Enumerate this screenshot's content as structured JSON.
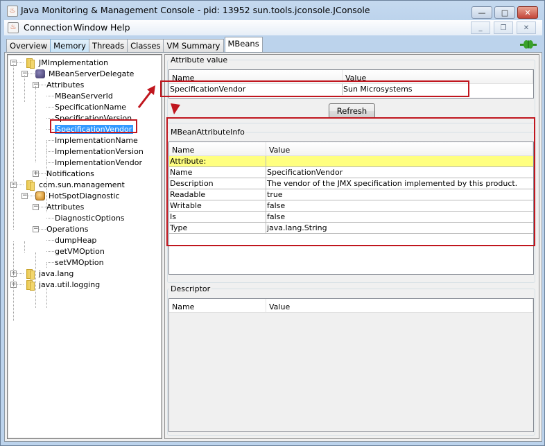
{
  "window": {
    "title": "Java Monitoring & Management Console - pid: 13952 sun.tools.jconsole.JConsole",
    "controls": {
      "minimize": "—",
      "maximize": "□",
      "close": "✕"
    }
  },
  "menubar": {
    "items": [
      "Connection",
      "Window",
      "Help"
    ],
    "inner_controls": {
      "minimize": "_",
      "restore": "❐",
      "close": "✕"
    }
  },
  "tabs": [
    {
      "label": "Overview",
      "state": "normal"
    },
    {
      "label": "Memory",
      "state": "hover"
    },
    {
      "label": "Threads",
      "state": "normal"
    },
    {
      "label": "Classes",
      "state": "normal"
    },
    {
      "label": "VM Summary",
      "state": "normal"
    },
    {
      "label": "MBeans",
      "state": "active"
    }
  ],
  "connection_icon": "connected-plug-icon",
  "tree": {
    "nodes": [
      {
        "label": "JMImplementation",
        "icon": "folder-icon",
        "level": 0,
        "expanded": true
      },
      {
        "label": "MBeanServerDelegate",
        "icon": "mbean-icon",
        "level": 1,
        "expanded": true
      },
      {
        "label": "Attributes",
        "icon": null,
        "level": 2,
        "expanded": true
      },
      {
        "label": "MBeanServerId",
        "level": 3
      },
      {
        "label": "SpecificationName",
        "level": 3
      },
      {
        "label": "SpecificationVersion",
        "level": 3
      },
      {
        "label": "SpecificationVendor",
        "level": 3,
        "selected": true
      },
      {
        "label": "ImplementationName",
        "level": 3
      },
      {
        "label": "ImplementationVersion",
        "level": 3
      },
      {
        "label": "ImplementationVendor",
        "level": 3
      },
      {
        "label": "Notifications",
        "level": 2,
        "expanded": false
      },
      {
        "label": "com.sun.management",
        "icon": "folder-icon",
        "level": 0,
        "expanded": true
      },
      {
        "label": "HotSpotDiagnostic",
        "icon": "mbean-icon",
        "level": 1,
        "expanded": true
      },
      {
        "label": "Attributes",
        "level": 2,
        "expanded": true
      },
      {
        "label": "DiagnosticOptions",
        "level": 3
      },
      {
        "label": "Operations",
        "level": 2,
        "expanded": true
      },
      {
        "label": "dumpHeap",
        "level": 3
      },
      {
        "label": "getVMOption",
        "level": 3
      },
      {
        "label": "setVMOption",
        "level": 3
      },
      {
        "label": "java.lang",
        "icon": "folder-icon",
        "level": 0,
        "expanded": false
      },
      {
        "label": "java.util.logging",
        "icon": "folder-icon",
        "level": 0,
        "expanded": false
      }
    ]
  },
  "attribute_value": {
    "title": "Attribute value",
    "columns": [
      "Name",
      "Value"
    ],
    "rows": [
      {
        "name": "SpecificationVendor",
        "value": "Sun Microsystems"
      }
    ],
    "refresh_label": "Refresh"
  },
  "mbean_attribute_info": {
    "title": "MBeanAttributeInfo",
    "columns": [
      "Name",
      "Value"
    ],
    "rows": [
      {
        "name": "Attribute:",
        "value": "",
        "highlight": true
      },
      {
        "name": "Name",
        "value": "SpecificationVendor"
      },
      {
        "name": "Description",
        "value": "The vendor of the JMX specification implemented by this product."
      },
      {
        "name": "Readable",
        "value": "true"
      },
      {
        "name": "Writable",
        "value": "false"
      },
      {
        "name": "Is",
        "value": "false"
      },
      {
        "name": "Type",
        "value": "java.lang.String"
      }
    ]
  },
  "descriptor": {
    "title": "Descriptor",
    "columns": [
      "Name",
      "Value"
    ],
    "rows": []
  },
  "colors": {
    "annotation_red": "#c0161e",
    "selection_blue": "#3399ff",
    "highlight_yellow": "#ffff80"
  }
}
